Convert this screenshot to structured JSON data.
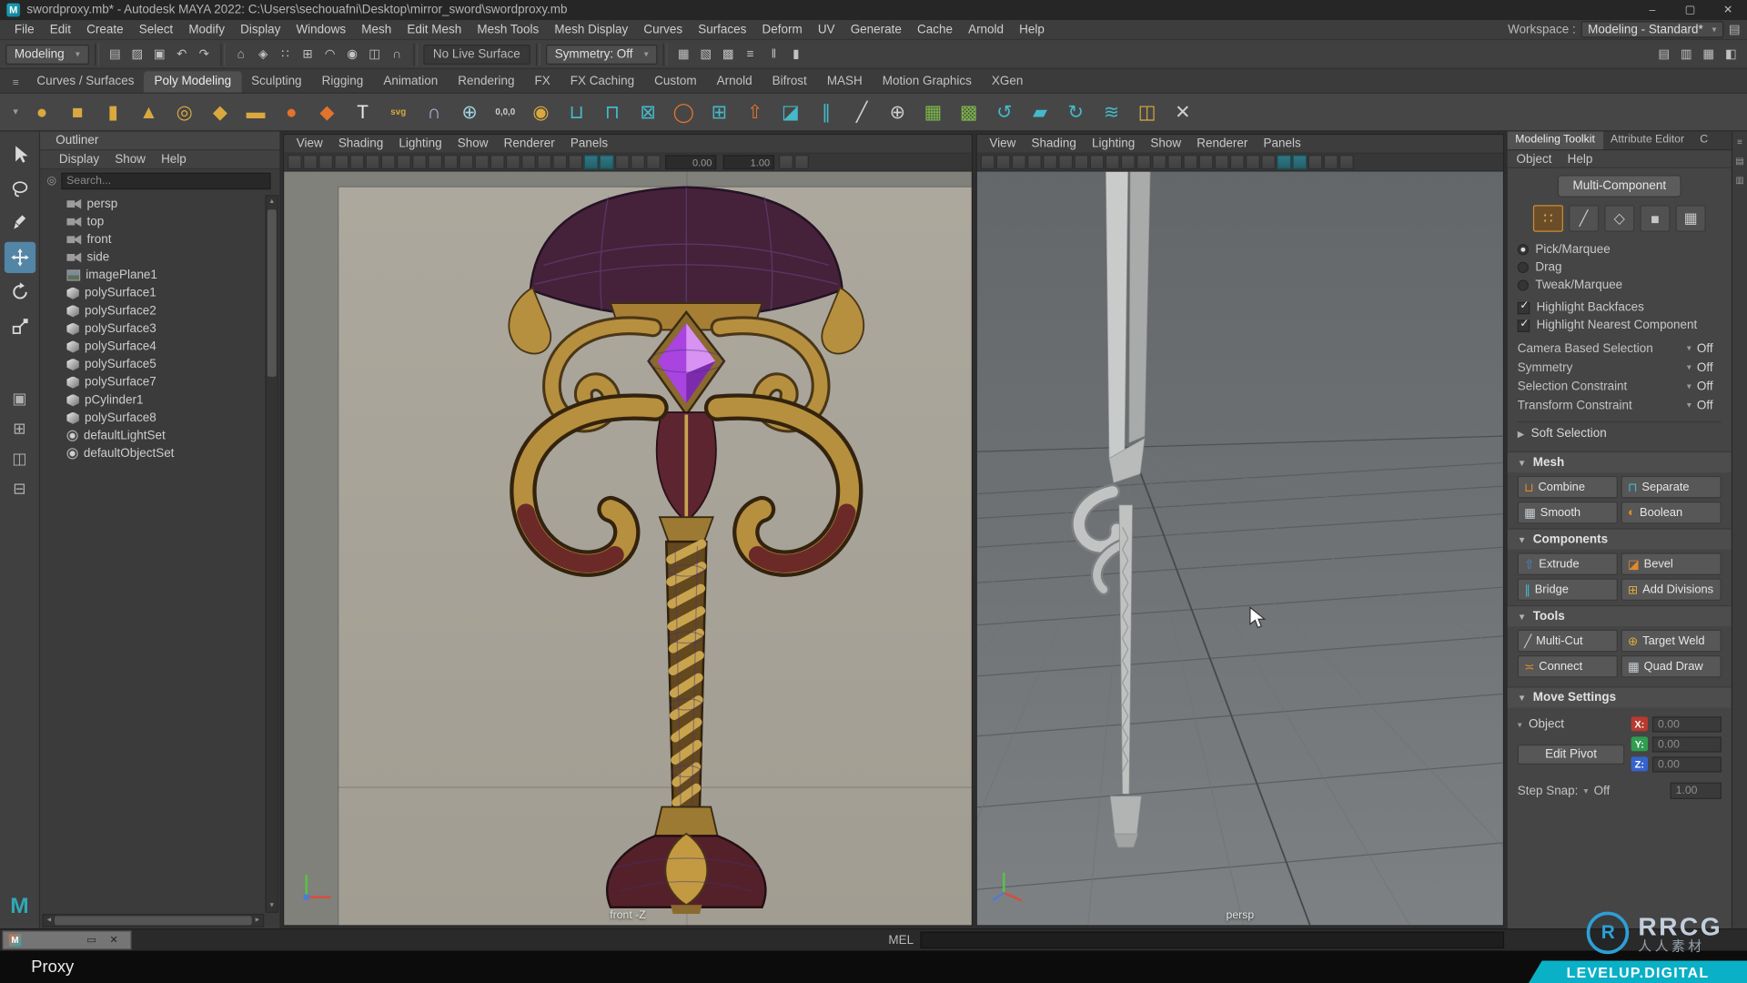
{
  "colors": {
    "accent_blue": "#5285a6",
    "banner_teal": "#0ab0c6",
    "axis_x": "#b8392f",
    "axis_y": "#2e9e4f",
    "axis_z": "#3563cc"
  },
  "title_bar": {
    "title": "swordproxy.mb* - Autodesk MAYA 2022: C:\\Users\\sechouafni\\Desktop\\mirror_sword\\swordproxy.mb"
  },
  "menu_bar": {
    "items": [
      "File",
      "Edit",
      "Create",
      "Select",
      "Modify",
      "Display",
      "Windows",
      "Mesh",
      "Edit Mesh",
      "Mesh Tools",
      "Mesh Display",
      "Curves",
      "Surfaces",
      "Deform",
      "UV",
      "Generate",
      "Cache",
      "Arnold",
      "Help"
    ],
    "workspace_label": "Workspace :",
    "workspace_value": "Modeling - Standard*"
  },
  "status_line": {
    "mode": "Modeling",
    "live_surface": "No Live Surface",
    "symmetry": "Symmetry: Off",
    "file_icons": [
      {
        "name": "new-scene-icon",
        "glyph": "▤"
      },
      {
        "name": "open-scene-icon",
        "glyph": "▨"
      },
      {
        "name": "save-scene-icon",
        "glyph": "▣"
      },
      {
        "name": "undo-icon",
        "glyph": "↶"
      },
      {
        "name": "redo-icon",
        "glyph": "↷"
      }
    ],
    "selection_icons": [
      {
        "name": "select-by-hierarchy-icon",
        "glyph": "⌂"
      },
      {
        "name": "select-by-object-icon",
        "glyph": "◈"
      },
      {
        "name": "select-by-component-icon",
        "glyph": "∷"
      },
      {
        "name": "snap-to-grid-icon",
        "glyph": "⊞"
      },
      {
        "name": "snap-to-curve-icon",
        "glyph": "◠"
      },
      {
        "name": "snap-to-point-icon",
        "glyph": "◉"
      },
      {
        "name": "snap-to-plane-icon",
        "glyph": "◫"
      },
      {
        "name": "make-live-icon",
        "glyph": "∩"
      }
    ],
    "render_icons": [
      {
        "name": "render-current-frame-icon",
        "glyph": "▦"
      },
      {
        "name": "ipr-render-icon",
        "glyph": "▧"
      },
      {
        "name": "render-settings-icon",
        "glyph": "▩"
      },
      {
        "name": "display-layer-icon",
        "glyph": "≡"
      }
    ],
    "playback_icons": [
      {
        "name": "pause-icon",
        "glyph": "‖"
      },
      {
        "name": "step-icon",
        "glyph": "▮"
      }
    ],
    "sidebar_icons": [
      {
        "name": "attribute-editor-toggle-icon",
        "glyph": "▤"
      },
      {
        "name": "tool-settings-toggle-icon",
        "glyph": "▥"
      },
      {
        "name": "channel-box-toggle-icon",
        "glyph": "▦"
      },
      {
        "name": "modeling-toolkit-toggle-icon",
        "glyph": "◧"
      }
    ]
  },
  "shelf": {
    "tabs": [
      "Curves / Surfaces",
      "Poly Modeling",
      "Sculpting",
      "Rigging",
      "Animation",
      "Rendering",
      "FX",
      "FX Caching",
      "Custom",
      "Arnold",
      "Bifrost",
      "MASH",
      "Motion Graphics",
      "XGen"
    ],
    "active_tab": "Poly Modeling",
    "icons": [
      {
        "name": "poly-sphere-icon",
        "glyph": "●",
        "color": "#d9a940"
      },
      {
        "name": "poly-cube-icon",
        "glyph": "■",
        "color": "#d9a940"
      },
      {
        "name": "poly-cylinder-icon",
        "glyph": "▮",
        "color": "#d9a940"
      },
      {
        "name": "poly-cone-icon",
        "glyph": "▲",
        "color": "#d9a940"
      },
      {
        "name": "poly-torus-icon",
        "glyph": "◎",
        "color": "#d9a940"
      },
      {
        "name": "poly-plane-icon",
        "glyph": "◆",
        "color": "#d9a940"
      },
      {
        "name": "poly-disc-icon",
        "glyph": "▬",
        "color": "#d9a940"
      },
      {
        "name": "sphere-primitive-icon",
        "glyph": "●",
        "color": "#e0742c"
      },
      {
        "name": "platonic-solid-icon",
        "glyph": "◆",
        "color": "#e0742c"
      },
      {
        "name": "type-tool-icon",
        "glyph": "T",
        "color": "#e8e8e8"
      },
      {
        "name": "svg-tool-icon",
        "glyph": "svg",
        "color": "#d9a940"
      },
      {
        "name": "make-live-shelf-icon",
        "glyph": "∩",
        "color": "#b7b7e0"
      },
      {
        "name": "snap-together-icon",
        "glyph": "⊕",
        "color": "#9fd3e0"
      },
      {
        "name": "origin-icon",
        "glyph": "0,0,0",
        "color": "#cfcfcf"
      },
      {
        "name": "lattice-icon",
        "glyph": "◉",
        "color": "#d9a940"
      },
      {
        "name": "combine-shelf-icon",
        "glyph": "⊔",
        "color": "#45b9c9"
      },
      {
        "name": "separate-shelf-icon",
        "glyph": "⊓",
        "color": "#45b9c9"
      },
      {
        "name": "boolean-shelf-icon",
        "glyph": "⊠",
        "color": "#45b9c9"
      },
      {
        "name": "smooth-shelf-icon",
        "glyph": "◯",
        "color": "#e0742c"
      },
      {
        "name": "subdivide-shelf-icon",
        "glyph": "⊞",
        "color": "#45b9c9"
      },
      {
        "name": "extrude-shelf-icon",
        "glyph": "⇧",
        "color": "#e0742c"
      },
      {
        "name": "bevel-shelf-icon",
        "glyph": "◪",
        "color": "#45b9c9"
      },
      {
        "name": "bridge-shelf-icon",
        "glyph": "∥",
        "color": "#45b9c9"
      },
      {
        "name": "multi-cut-shelf-icon",
        "glyph": "╱",
        "color": "#cfcfcf"
      },
      {
        "name": "target-weld-shelf-icon",
        "glyph": "⊕",
        "color": "#cfcfcf"
      },
      {
        "name": "quad-draw-shelf-icon",
        "glyph": "▦",
        "color": "#7db84a"
      },
      {
        "name": "mash-network-icon",
        "glyph": "▩",
        "color": "#7db84a"
      },
      {
        "name": "curve-warp-icon",
        "glyph": "↺",
        "color": "#45b9c9"
      },
      {
        "name": "crease-tool-icon",
        "glyph": "▰",
        "color": "#45b9c9"
      },
      {
        "name": "spin-edge-icon",
        "glyph": "↻",
        "color": "#45b9c9"
      },
      {
        "name": "conform-icon",
        "glyph": "≋",
        "color": "#45b9c9"
      },
      {
        "name": "mirror-icon",
        "glyph": "◫",
        "color": "#d9a940"
      },
      {
        "name": "cut-tool-icon",
        "glyph": "✕",
        "color": "#cfcfcf"
      }
    ]
  },
  "tool_box": {
    "tools": [
      {
        "name": "select-tool",
        "active": false
      },
      {
        "name": "lasso-tool",
        "active": false
      },
      {
        "name": "paint-select-tool",
        "active": false
      },
      {
        "name": "move-tool",
        "active": true
      },
      {
        "name": "rotate-tool",
        "active": false
      },
      {
        "name": "scale-tool",
        "active": false
      }
    ],
    "layouts": [
      "single-pane-layout",
      "four-pane-layout",
      "outliner-persp-layout",
      "two-pane-layout"
    ]
  },
  "outliner": {
    "title": "Outliner",
    "menus": [
      "Display",
      "Show",
      "Help"
    ],
    "search_placeholder": "Search...",
    "items": [
      {
        "label": "persp",
        "icon": "camera"
      },
      {
        "label": "top",
        "icon": "camera"
      },
      {
        "label": "front",
        "icon": "camera"
      },
      {
        "label": "side",
        "icon": "camera"
      },
      {
        "label": "imagePlane1",
        "icon": "image-plane"
      },
      {
        "label": "polySurface1",
        "icon": "mesh"
      },
      {
        "label": "polySurface2",
        "icon": "mesh"
      },
      {
        "label": "polySurface3",
        "icon": "mesh"
      },
      {
        "label": "polySurface4",
        "icon": "mesh"
      },
      {
        "label": "polySurface5",
        "icon": "mesh"
      },
      {
        "label": "polySurface7",
        "icon": "mesh"
      },
      {
        "label": "pCylinder1",
        "icon": "mesh"
      },
      {
        "label": "polySurface8",
        "icon": "mesh"
      },
      {
        "label": "defaultLightSet",
        "icon": "set"
      },
      {
        "label": "defaultObjectSet",
        "icon": "set"
      }
    ]
  },
  "viewport_front": {
    "menus": [
      "View",
      "Shading",
      "Lighting",
      "Show",
      "Renderer",
      "Panels"
    ],
    "bar_icons": [
      "renderer-select-icon",
      "lighting-icon",
      "shadows-icon",
      "ao-icon",
      "motion-blur-icon",
      "camera-select-icon",
      "camera-lock-icon",
      "camera-attributes-icon",
      "bookmark-icon",
      "image-plane-icon",
      "pan-zoom-icon",
      "grease-pencil-icon",
      "grid-icon",
      "film-gate-icon",
      "resolution-gate-icon",
      "gate-mask-icon",
      "field-chart-icon",
      "safe-action-icon",
      "safe-title-icon",
      "smooth-shade-icon",
      "textured-icon",
      "wireframe-icon",
      "xray-icon",
      "isolate-select-icon"
    ],
    "bar_icons_tail": [
      "exposure-toggle-icon",
      "viewport-options-icon"
    ],
    "active_bar_icons": [
      "smooth-shade-icon",
      "textured-icon"
    ],
    "field_1": "0.00",
    "field_2": "1.00",
    "label": "front -Z"
  },
  "viewport_persp": {
    "menus": [
      "View",
      "Shading",
      "Lighting",
      "Show",
      "Renderer",
      "Panels"
    ],
    "bar_icons": [
      "renderer-select-icon",
      "lighting-icon",
      "shadows-icon",
      "ao-icon",
      "motion-blur-icon",
      "camera-select-icon",
      "camera-lock-icon",
      "camera-attributes-icon",
      "bookmark-icon",
      "image-plane-icon",
      "pan-zoom-icon",
      "grease-pencil-icon",
      "grid-icon",
      "film-gate-icon",
      "resolution-gate-icon",
      "gate-mask-icon",
      "field-chart-icon",
      "safe-action-icon",
      "safe-title-icon",
      "smooth-shade-icon",
      "textured-icon",
      "wireframe-icon",
      "xray-icon",
      "isolate-select-icon"
    ],
    "active_bar_icons": [
      "smooth-shade-icon",
      "textured-icon"
    ],
    "label": "persp"
  },
  "toolkit": {
    "tabs": [
      {
        "label": "Modeling Toolkit",
        "active": true
      },
      {
        "label": "Attribute Editor",
        "active": false
      },
      {
        "label": "C",
        "active": false
      }
    ],
    "menus": [
      "Object",
      "Help"
    ],
    "multi_component_label": "Multi-Component",
    "component_icons": [
      {
        "name": "vertex-mode-icon",
        "active": true
      },
      {
        "name": "edge-mode-icon",
        "active": false
      },
      {
        "name": "face-mode-icon",
        "active": false
      },
      {
        "name": "object-mode-icon",
        "active": false
      },
      {
        "name": "uv-mode-icon",
        "active": false
      }
    ],
    "radios": [
      {
        "label": "Pick/Marquee",
        "selected": true
      },
      {
        "label": "Drag",
        "selected": false
      },
      {
        "label": "Tweak/Marquee",
        "selected": false
      }
    ],
    "checkboxes": [
      {
        "label": "Highlight Backfaces",
        "checked": true
      },
      {
        "label": "Highlight Nearest Component",
        "checked": true
      }
    ],
    "dropdown_rows": [
      {
        "label": "Camera Based Selection",
        "value": "Off"
      },
      {
        "label": "Symmetry",
        "value": "Off"
      },
      {
        "label": "Selection Constraint",
        "value": "Off"
      },
      {
        "label": "Transform Constraint",
        "value": "Off"
      }
    ],
    "soft_selection_label": "Soft Selection",
    "sections": [
      {
        "title": "Mesh",
        "buttons": [
          {
            "label": "Combine",
            "icon_color": "#e0892c",
            "glyph": "⊔"
          },
          {
            "label": "Separate",
            "icon_color": "#45b9c9",
            "glyph": "⊓"
          },
          {
            "label": "Smooth",
            "icon_color": "#c9cfd4",
            "glyph": "▦"
          },
          {
            "label": "Boolean",
            "icon_color": "#e0892c",
            "glyph": "◐"
          }
        ]
      },
      {
        "title": "Components",
        "buttons": [
          {
            "label": "Extrude",
            "icon_color": "#4a86c9",
            "glyph": "⇧"
          },
          {
            "label": "Bevel",
            "icon_color": "#e0892c",
            "glyph": "◪"
          },
          {
            "label": "Bridge",
            "icon_color": "#45b9c9",
            "glyph": "∥"
          },
          {
            "label": "Add Divisions",
            "icon_color": "#d9a940",
            "glyph": "⊞"
          }
        ]
      },
      {
        "title": "Tools",
        "buttons": [
          {
            "label": "Multi-Cut",
            "icon_color": "#c9cfd4",
            "glyph": "╱"
          },
          {
            "label": "Target Weld",
            "icon_color": "#d9a940",
            "glyph": "⊕"
          },
          {
            "label": "Connect",
            "icon_color": "#e0892c",
            "glyph": "≍"
          },
          {
            "label": "Quad Draw",
            "icon_color": "#c9cfd4",
            "glyph": "▦"
          }
        ]
      }
    ],
    "move_settings": {
      "title": "Move Settings",
      "object_label": "Object",
      "edit_pivot_label": "Edit Pivot",
      "axes": [
        {
          "label": "X:",
          "value": "0.00",
          "color": "#b8392f"
        },
        {
          "label": "Y:",
          "value": "0.00",
          "color": "#2e9e4f"
        },
        {
          "label": "Z:",
          "value": "0.00",
          "color": "#3563cc"
        }
      ],
      "step_snap_label": "Step Snap:",
      "step_snap_value": "Off",
      "step_field": "1.00"
    }
  },
  "command_line": {
    "label": "MEL"
  },
  "bottom": {
    "proxy_label": "Proxy",
    "watermark_title": "RRCG",
    "watermark_sub": "人人素材",
    "banner": "LEVELUP.DIGITAL"
  }
}
